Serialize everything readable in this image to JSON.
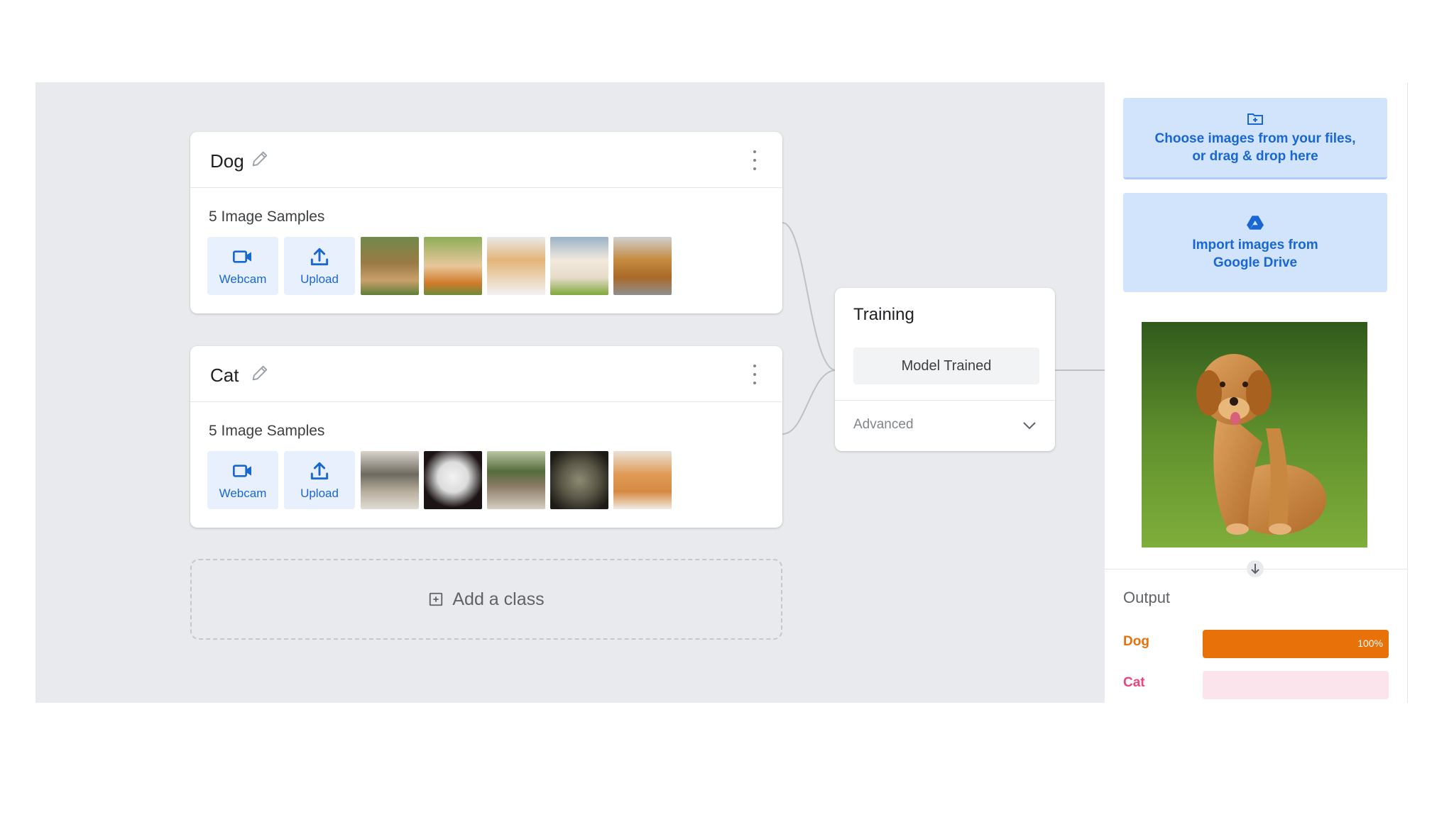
{
  "classes": [
    {
      "name": "Dog",
      "samples_label": "5 Image Samples",
      "webcam_label": "Webcam",
      "upload_label": "Upload",
      "thumbnails": [
        "dog-sample-1",
        "dog-sample-2",
        "dog-sample-3",
        "dog-sample-4",
        "dog-sample-5"
      ]
    },
    {
      "name": "Cat",
      "samples_label": "5 Image Samples",
      "webcam_label": "Webcam",
      "upload_label": "Upload",
      "thumbnails": [
        "cat-sample-1",
        "cat-sample-2",
        "cat-sample-3",
        "cat-sample-4",
        "cat-sample-5"
      ]
    }
  ],
  "add_class_label": "Add a class",
  "training": {
    "title": "Training",
    "button_label": "Model Trained",
    "advanced_label": "Advanced"
  },
  "preview": {
    "choose_files_text": "Choose images from your files, or drag & drop here",
    "drive_text": "Import images from Google Drive"
  },
  "output": {
    "title": "Output",
    "results": [
      {
        "label": "Dog",
        "confidence": 1.0,
        "percent_label": "100%",
        "color": "#e8710a"
      },
      {
        "label": "Cat",
        "confidence": 0.0,
        "color": "#e8467c"
      }
    ]
  },
  "colors": {
    "canvas_bg": "#e8eaed",
    "accent_blue": "#1967d2",
    "upload_box_bg": "#d2e3fc"
  },
  "icons": [
    "pencil-icon",
    "more-vert-icon",
    "webcam-icon",
    "upload-icon",
    "add-box-icon",
    "chevron-down-icon",
    "folder-add-icon",
    "google-drive-icon",
    "arrow-down-circle-icon"
  ]
}
